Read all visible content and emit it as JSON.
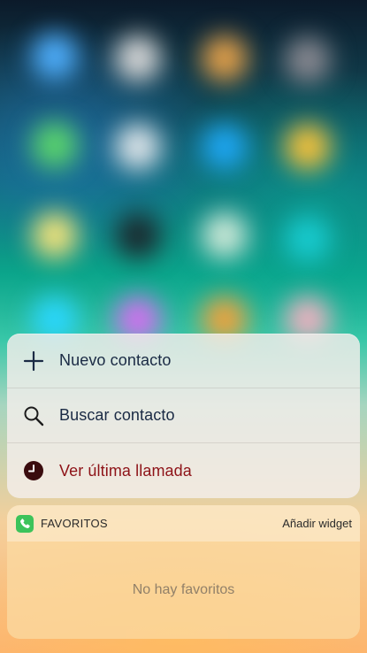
{
  "quick_actions": {
    "items": [
      {
        "label": "Nuevo contacto",
        "icon": "plus-icon"
      },
      {
        "label": "Buscar contacto",
        "icon": "search-icon"
      },
      {
        "label": "Ver última llamada",
        "icon": "clock-icon"
      }
    ]
  },
  "widget": {
    "title": "FAVORITOS",
    "add_label": "Añadir widget",
    "empty_message": "No hay favoritos"
  },
  "colors": {
    "accent_red": "#8e1318",
    "phone_green": "#3cc35a",
    "text_dark": "#1a2a44"
  }
}
